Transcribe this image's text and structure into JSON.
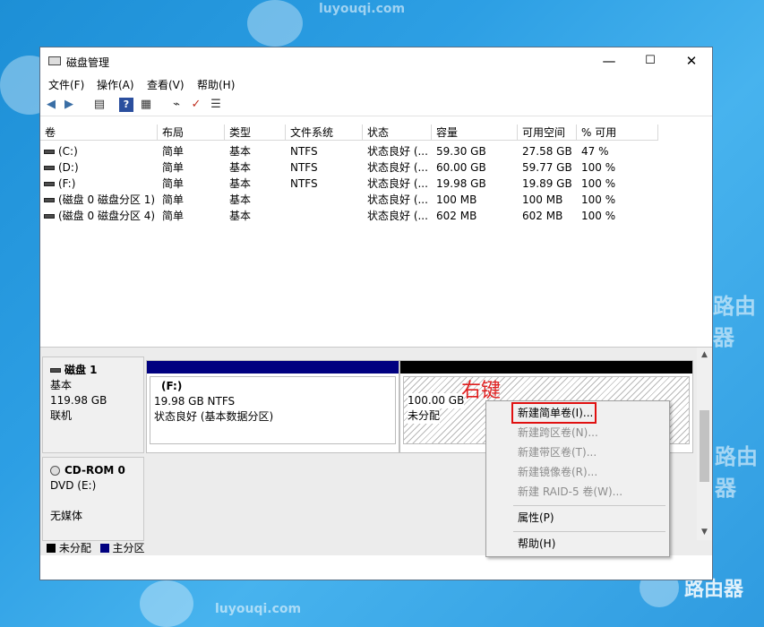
{
  "window": {
    "title": "磁盘管理"
  },
  "menu": [
    "文件(F)",
    "操作(A)",
    "查看(V)",
    "帮助(H)"
  ],
  "columns": [
    "卷",
    "布局",
    "类型",
    "文件系统",
    "状态",
    "容量",
    "可用空间",
    "% 可用"
  ],
  "volumes": [
    [
      "(C:)",
      "简单",
      "基本",
      "NTFS",
      "状态良好 (...",
      "59.30 GB",
      "27.58 GB",
      "47 %"
    ],
    [
      "(D:)",
      "简单",
      "基本",
      "NTFS",
      "状态良好 (...",
      "60.00 GB",
      "59.77 GB",
      "100 %"
    ],
    [
      "(F:)",
      "简单",
      "基本",
      "NTFS",
      "状态良好 (...",
      "19.98 GB",
      "19.89 GB",
      "100 %"
    ],
    [
      "(磁盘 0 磁盘分区 1)",
      "简单",
      "基本",
      "",
      "状态良好 (...",
      "100 MB",
      "100 MB",
      "100 %"
    ],
    [
      "(磁盘 0 磁盘分区 4)",
      "简单",
      "基本",
      "",
      "状态良好 (...",
      "602 MB",
      "602 MB",
      "100 %"
    ]
  ],
  "disk1": {
    "name": "磁盘 1",
    "type": "基本",
    "size": "119.98 GB",
    "status": "联机",
    "part_f": {
      "label": "(F:)",
      "size": "19.98 GB NTFS",
      "status": "状态良好 (基本数据分区)"
    },
    "part_unalloc": {
      "size": "100.00 GB",
      "status": "未分配"
    }
  },
  "cdrom": {
    "name": "CD-ROM 0",
    "drive": "DVD (E:)",
    "status": "无媒体"
  },
  "legend": {
    "unallocated": "未分配",
    "primary": "主分区"
  },
  "annotation": "右键",
  "context_menu": {
    "new_simple": "新建简单卷(I)...",
    "new_spanned": "新建跨区卷(N)...",
    "new_striped": "新建带区卷(T)...",
    "new_mirrored": "新建镜像卷(R)...",
    "new_raid5": "新建 RAID-5 卷(W)...",
    "properties": "属性(P)",
    "help": "帮助(H)"
  },
  "watermark": {
    "text1": "luyouqi.com",
    "text2": "路由器"
  },
  "colors": {
    "primary_partition": "#000080",
    "unallocated": "#000000",
    "highlight": "#e01010",
    "annotation": "#e02020"
  }
}
